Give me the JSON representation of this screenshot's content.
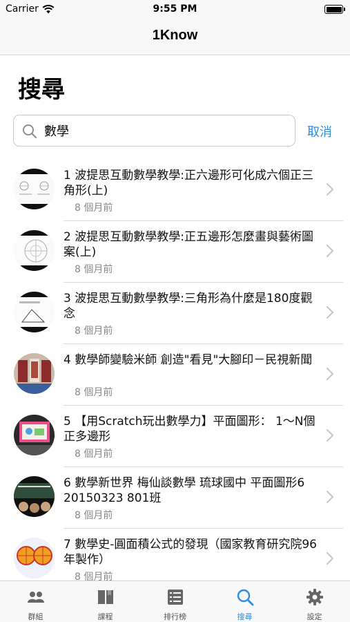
{
  "status_bar": {
    "carrier": "Carrier",
    "time": "9:55 PM"
  },
  "nav": {
    "title": "1Know"
  },
  "page": {
    "title": "搜尋"
  },
  "search": {
    "value": "數學",
    "cancel_label": "取消"
  },
  "results": [
    {
      "title": "1 波提思互動數學教學:正六邊形可化成六個正三角形(上)",
      "time": "8 個月前"
    },
    {
      "title": "2 波提思互動數學教學:正五邊形怎麼畫與藝術圖案(上)",
      "time": "8 個月前"
    },
    {
      "title": "3 波提思互動數學教學:三角形為什麼是180度觀念",
      "time": "8 個月前"
    },
    {
      "title": "4 數學師變驗米師 創造\"看見\"大腳印－民視新聞",
      "time": "8 個月前"
    },
    {
      "title": "5 【用Scratch玩出數學力】平面圖形： 1～N個正多邊形",
      "time": "8 個月前"
    },
    {
      "title": "6 數學新世界 梅仙談數學 琉球國中 平面圖形6 20150323 801班",
      "time": "8 個月前"
    },
    {
      "title": "7 數學史-圓面積公式的發現（國家教育研究院96年製作）",
      "time": "8 個月前"
    }
  ],
  "tabs": [
    {
      "label": "群組",
      "icon": "group-icon"
    },
    {
      "label": "課程",
      "icon": "book-icon"
    },
    {
      "label": "排行榜",
      "icon": "list-icon"
    },
    {
      "label": "搜尋",
      "icon": "search-icon"
    },
    {
      "label": "設定",
      "icon": "gear-icon"
    }
  ],
  "active_tab": "搜尋",
  "colors": {
    "accent": "#2b8ce4",
    "muted": "#888888"
  }
}
